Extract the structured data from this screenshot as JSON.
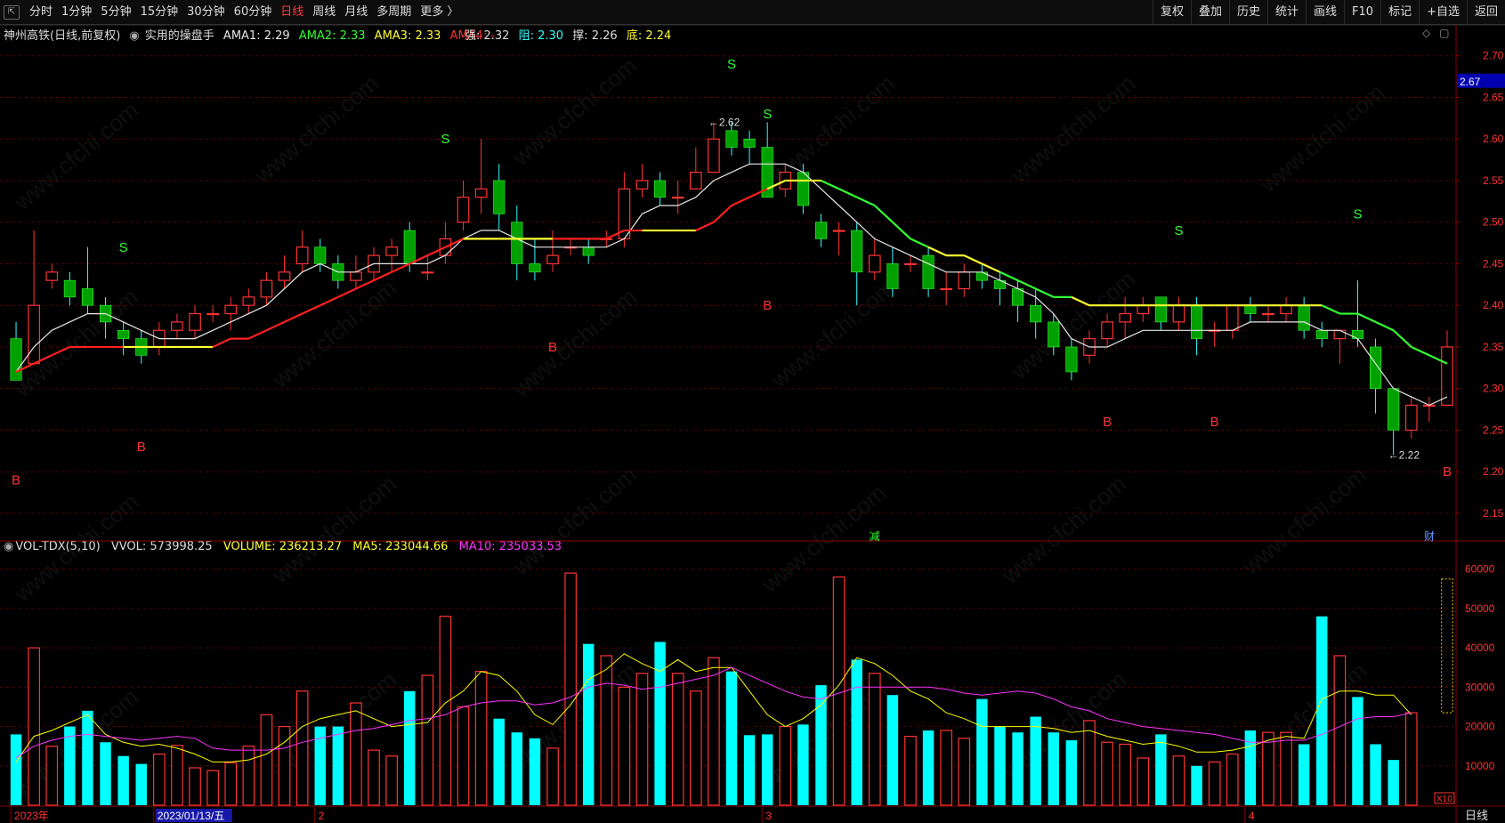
{
  "toolbar": {
    "periods": [
      "分时",
      "1分钟",
      "5分钟",
      "15分钟",
      "30分钟",
      "60分钟",
      "日线",
      "周线",
      "月线",
      "多周期",
      "更多 〉"
    ],
    "active_period": "日线",
    "right_buttons": [
      "复权",
      "叠加",
      "历史",
      "统计",
      "画线",
      "F10",
      "标记",
      "+自选",
      "返回"
    ]
  },
  "header": {
    "stock_name": "神州高铁(日线,前复权)",
    "indicator_name": "实用的操盘手",
    "ama1": "AMA1: 2.29",
    "ama2": "AMA2: 2.33",
    "ama3": "AMA3: 2.33",
    "ama4": "AMA4: -",
    "strong": "强: 2.32",
    "resist": "阻: 2.30",
    "support": "撑: 2.26",
    "bottom": "底: 2.24"
  },
  "volume_header": {
    "name": "VOL-TDX(5,10)",
    "vvol": "VVOL: 573998.25",
    "volume": "VOLUME: 236213.27",
    "ma5": "MA5: 233044.66",
    "ma10": "MA10: 235033.53"
  },
  "colors": {
    "up": "#ff3333",
    "down": "#00a000",
    "vol_down": "#00ffff",
    "ama_white": "#e8e8e8",
    "ama_red": "#ff2020",
    "ama_yellow": "#ffff33",
    "ama_green": "#33ff33",
    "ma5": "#ffff00",
    "ma10": "#ff33ff",
    "grid": "#5a0000"
  },
  "corner_icons": [
    "diamond-icon",
    "panel-icon"
  ],
  "current_price_tag": "2.67",
  "event_marks": [
    "减",
    "财"
  ],
  "volume_unit_tag": "X10",
  "period_tag": "日线",
  "chart_data": [
    {
      "type": "candlestick",
      "ylim": [
        2.12,
        2.72
      ],
      "yticks": [
        "2.70",
        "2.65",
        "2.60",
        "2.55",
        "2.50",
        "2.45",
        "2.40",
        "2.35",
        "2.30",
        "2.25",
        "2.20",
        "2.15"
      ],
      "candles": [
        [
          2.36,
          2.31,
          2.38,
          2.31
        ],
        [
          2.33,
          2.4,
          2.49,
          2.33
        ],
        [
          2.43,
          2.44,
          2.45,
          2.42
        ],
        [
          2.43,
          2.41,
          2.44,
          2.4
        ],
        [
          2.42,
          2.4,
          2.47,
          2.39
        ],
        [
          2.4,
          2.38,
          2.41,
          2.36
        ],
        [
          2.37,
          2.36,
          2.38,
          2.34
        ],
        [
          2.36,
          2.34,
          2.37,
          2.33
        ],
        [
          2.35,
          2.37,
          2.38,
          2.34
        ],
        [
          2.37,
          2.38,
          2.39,
          2.36
        ],
        [
          2.37,
          2.39,
          2.4,
          2.36
        ],
        [
          2.39,
          2.39,
          2.4,
          2.38
        ],
        [
          2.39,
          2.4,
          2.41,
          2.37
        ],
        [
          2.4,
          2.41,
          2.42,
          2.39
        ],
        [
          2.41,
          2.43,
          2.44,
          2.4
        ],
        [
          2.43,
          2.44,
          2.46,
          2.42
        ],
        [
          2.45,
          2.47,
          2.49,
          2.44
        ],
        [
          2.47,
          2.45,
          2.48,
          2.44
        ],
        [
          2.45,
          2.43,
          2.46,
          2.42
        ],
        [
          2.43,
          2.44,
          2.46,
          2.42
        ],
        [
          2.44,
          2.46,
          2.47,
          2.43
        ],
        [
          2.46,
          2.47,
          2.48,
          2.44
        ],
        [
          2.49,
          2.45,
          2.5,
          2.44
        ],
        [
          2.44,
          2.44,
          2.46,
          2.43
        ],
        [
          2.46,
          2.48,
          2.5,
          2.45
        ],
        [
          2.5,
          2.53,
          2.55,
          2.49
        ],
        [
          2.53,
          2.54,
          2.6,
          2.51
        ],
        [
          2.55,
          2.51,
          2.57,
          2.49
        ],
        [
          2.5,
          2.45,
          2.52,
          2.43
        ],
        [
          2.45,
          2.44,
          2.48,
          2.43
        ],
        [
          2.45,
          2.46,
          2.49,
          2.44
        ],
        [
          2.47,
          2.47,
          2.48,
          2.46
        ],
        [
          2.47,
          2.46,
          2.48,
          2.45
        ],
        [
          2.48,
          2.48,
          2.49,
          2.47
        ],
        [
          2.48,
          2.54,
          2.56,
          2.47
        ],
        [
          2.54,
          2.55,
          2.57,
          2.53
        ],
        [
          2.55,
          2.53,
          2.56,
          2.52
        ],
        [
          2.53,
          2.53,
          2.55,
          2.51
        ],
        [
          2.54,
          2.56,
          2.59,
          2.54
        ],
        [
          2.56,
          2.6,
          2.62,
          2.56
        ],
        [
          2.61,
          2.59,
          2.62,
          2.58
        ],
        [
          2.6,
          2.59,
          2.61,
          2.57
        ],
        [
          2.59,
          2.53,
          2.62,
          2.53
        ],
        [
          2.54,
          2.56,
          2.57,
          2.53
        ],
        [
          2.56,
          2.52,
          2.57,
          2.51
        ],
        [
          2.5,
          2.48,
          2.51,
          2.47
        ],
        [
          2.49,
          2.49,
          2.5,
          2.46
        ],
        [
          2.49,
          2.44,
          2.5,
          2.4
        ],
        [
          2.44,
          2.46,
          2.48,
          2.43
        ],
        [
          2.45,
          2.42,
          2.47,
          2.41
        ],
        [
          2.45,
          2.45,
          2.46,
          2.44
        ],
        [
          2.46,
          2.42,
          2.47,
          2.41
        ],
        [
          2.42,
          2.42,
          2.44,
          2.4
        ],
        [
          2.42,
          2.44,
          2.45,
          2.41
        ],
        [
          2.44,
          2.43,
          2.45,
          2.42
        ],
        [
          2.43,
          2.42,
          2.44,
          2.4
        ],
        [
          2.42,
          2.4,
          2.43,
          2.38
        ],
        [
          2.4,
          2.38,
          2.42,
          2.36
        ],
        [
          2.38,
          2.35,
          2.39,
          2.34
        ],
        [
          2.35,
          2.32,
          2.36,
          2.31
        ],
        [
          2.34,
          2.36,
          2.37,
          2.33
        ],
        [
          2.36,
          2.38,
          2.39,
          2.35
        ],
        [
          2.38,
          2.39,
          2.41,
          2.36
        ],
        [
          2.39,
          2.4,
          2.41,
          2.38
        ],
        [
          2.41,
          2.38,
          2.41,
          2.37
        ],
        [
          2.38,
          2.4,
          2.41,
          2.37
        ],
        [
          2.4,
          2.36,
          2.41,
          2.34
        ],
        [
          2.37,
          2.37,
          2.38,
          2.35
        ],
        [
          2.37,
          2.4,
          2.4,
          2.36
        ],
        [
          2.4,
          2.39,
          2.41,
          2.38
        ],
        [
          2.39,
          2.39,
          2.4,
          2.38
        ],
        [
          2.39,
          2.4,
          2.41,
          2.38
        ],
        [
          2.4,
          2.37,
          2.41,
          2.36
        ],
        [
          2.37,
          2.36,
          2.38,
          2.35
        ],
        [
          2.36,
          2.37,
          2.37,
          2.33
        ],
        [
          2.37,
          2.36,
          2.43,
          2.35
        ],
        [
          2.35,
          2.3,
          2.36,
          2.27
        ],
        [
          2.3,
          2.25,
          2.3,
          2.22
        ],
        [
          2.25,
          2.28,
          2.29,
          2.24
        ],
        [
          2.28,
          2.28,
          2.29,
          2.26
        ],
        [
          2.28,
          2.35,
          2.37,
          2.28
        ]
      ],
      "ama_fast": [
        2.32,
        2.35,
        2.37,
        2.38,
        2.39,
        2.39,
        2.38,
        2.37,
        2.36,
        2.36,
        2.36,
        2.37,
        2.38,
        2.39,
        2.4,
        2.42,
        2.44,
        2.45,
        2.44,
        2.44,
        2.45,
        2.45,
        2.45,
        2.45,
        2.46,
        2.48,
        2.49,
        2.49,
        2.48,
        2.47,
        2.47,
        2.47,
        2.47,
        2.47,
        2.48,
        2.51,
        2.52,
        2.52,
        2.53,
        2.55,
        2.56,
        2.57,
        2.57,
        2.57,
        2.56,
        2.54,
        2.52,
        2.5,
        2.48,
        2.47,
        2.46,
        2.45,
        2.44,
        2.44,
        2.44,
        2.43,
        2.42,
        2.41,
        2.39,
        2.36,
        2.35,
        2.35,
        2.36,
        2.37,
        2.37,
        2.37,
        2.37,
        2.37,
        2.37,
        2.38,
        2.38,
        2.38,
        2.38,
        2.37,
        2.37,
        2.36,
        2.33,
        2.3,
        2.29,
        2.28,
        2.29
      ],
      "ama_slow_seg1": [
        2.32,
        2.33,
        2.34,
        2.35,
        2.35,
        2.35,
        2.35,
        2.35,
        2.35,
        2.35,
        2.35,
        2.35,
        2.36,
        2.36,
        2.37,
        2.38,
        2.39,
        2.4,
        2.41,
        2.42,
        2.43,
        2.44,
        2.45,
        2.46,
        2.47,
        2.48,
        2.48,
        2.48,
        2.48,
        2.48,
        2.48,
        2.48,
        2.48,
        2.48,
        2.49,
        2.49,
        2.49,
        2.49,
        2.49,
        2.5,
        2.52,
        2.53,
        2.54,
        2.55,
        2.55,
        2.55,
        2.54,
        2.53,
        2.52,
        2.5,
        2.48,
        2.47,
        2.46,
        2.46,
        2.45,
        2.44,
        2.43,
        2.42,
        2.41,
        2.41,
        2.4,
        2.4,
        2.4,
        2.4,
        2.4,
        2.4,
        2.4,
        2.4,
        2.4,
        2.4,
        2.4,
        2.4,
        2.4,
        2.4,
        2.39,
        2.39,
        2.38,
        2.37,
        2.35,
        2.34,
        2.33
      ],
      "ama_slow_colors": [
        "red",
        "red",
        "red",
        "red",
        "red",
        "red",
        "red",
        "yellow",
        "yellow",
        "yellow",
        "yellow",
        "yellow",
        "red",
        "red",
        "red",
        "red",
        "red",
        "red",
        "red",
        "red",
        "red",
        "red",
        "red",
        "red",
        "red",
        "red",
        "yellow",
        "yellow",
        "yellow",
        "yellow",
        "yellow",
        "red",
        "red",
        "red",
        "red",
        "red",
        "yellow",
        "yellow",
        "yellow",
        "red",
        "red",
        "red",
        "red",
        "yellow",
        "yellow",
        "yellow",
        "green",
        "green",
        "green",
        "green",
        "green",
        "green",
        "yellow",
        "yellow",
        "yellow",
        "yellow",
        "green",
        "green",
        "green",
        "green",
        "yellow",
        "yellow",
        "yellow",
        "yellow",
        "yellow",
        "yellow",
        "yellow",
        "yellow",
        "yellow",
        "yellow",
        "yellow",
        "yellow",
        "yellow",
        "yellow",
        "green",
        "green",
        "green",
        "green",
        "green",
        "green",
        "green"
      ],
      "signals": [
        {
          "label": "S",
          "i": 6,
          "price": 2.47
        },
        {
          "label": "S",
          "i": 24,
          "price": 2.6
        },
        {
          "label": "S",
          "i": 40,
          "price": 2.69
        },
        {
          "label": "S",
          "i": 42,
          "price": 2.63
        },
        {
          "label": "S",
          "i": 65,
          "price": 2.49
        },
        {
          "label": "S",
          "i": 75,
          "price": 2.51
        },
        {
          "label": "B",
          "i": 0,
          "price": 2.19
        },
        {
          "label": "B",
          "i": 7,
          "price": 2.23
        },
        {
          "label": "B",
          "i": 30,
          "price": 2.35
        },
        {
          "label": "B",
          "i": 42,
          "price": 2.4
        },
        {
          "label": "B",
          "i": 61,
          "price": 2.26
        },
        {
          "label": "B",
          "i": 67,
          "price": 2.26
        },
        {
          "label": "B",
          "i": 80,
          "price": 2.2
        }
      ],
      "annotations": [
        {
          "text": "2.62",
          "i": 39,
          "price": 2.62
        },
        {
          "text": "2.22",
          "i": 77,
          "price": 2.22
        }
      ]
    },
    {
      "type": "bar",
      "ylim": [
        0,
        64000
      ],
      "yticks": [
        "60000",
        "50000",
        "40000",
        "30000",
        "20000",
        "10000"
      ],
      "volumes": [
        18000,
        40000,
        15000,
        20000,
        24000,
        16000,
        12500,
        10500,
        13000,
        15200,
        9500,
        8800,
        10800,
        15000,
        23000,
        20000,
        29000,
        20000,
        20000,
        26000,
        14000,
        12500,
        29000,
        33000,
        48000,
        25000,
        34000,
        22000,
        18500,
        17000,
        14500,
        59000,
        41000,
        38000,
        30000,
        33500,
        41500,
        33500,
        29000,
        37500,
        34000,
        17800,
        18000,
        20000,
        20500,
        30500,
        58000,
        37000,
        33500,
        28000,
        17500,
        19000,
        19000,
        17000,
        27000,
        20000,
        18500,
        22500,
        18500,
        16500,
        21500,
        16000,
        15500,
        12000,
        18000,
        12500,
        10000,
        11000,
        13000,
        19000,
        18500,
        18500,
        15500,
        48000,
        38000,
        27500,
        15500,
        11500,
        23500
      ],
      "ma5": [
        11000,
        17500,
        19000,
        21000,
        23000,
        18000,
        16000,
        15000,
        15500,
        14500,
        13000,
        11000,
        11000,
        11500,
        13000,
        16000,
        20000,
        22000,
        23000,
        24000,
        22000,
        20000,
        20500,
        21000,
        26000,
        29000,
        34000,
        33000,
        29000,
        23000,
        20500,
        25500,
        32000,
        34500,
        38500,
        36000,
        34000,
        37000,
        34000,
        35000,
        35000,
        29000,
        23000,
        20000,
        22000,
        25500,
        30500,
        37500,
        36000,
        33000,
        29000,
        27000,
        23500,
        22000,
        20000,
        20000,
        20000,
        20000,
        19500,
        18500,
        19000,
        17500,
        16500,
        15500,
        16000,
        15000,
        13500,
        13500,
        14000,
        15000,
        16500,
        17500,
        17000,
        27000,
        29000,
        29000,
        28000,
        28000,
        23000
      ],
      "ma10": [
        12000,
        15000,
        16500,
        17500,
        18000,
        17500,
        17000,
        16500,
        17000,
        17500,
        17000,
        14500,
        14000,
        14000,
        14000,
        14500,
        16000,
        17000,
        18000,
        19000,
        19500,
        20500,
        21500,
        22000,
        23000,
        25000,
        26000,
        26500,
        26500,
        25500,
        26000,
        27500,
        30000,
        31000,
        30500,
        29500,
        30000,
        31000,
        32000,
        33000,
        35000,
        33000,
        31000,
        29000,
        27500,
        27000,
        28500,
        30000,
        30000,
        30000,
        30000,
        30000,
        29500,
        28500,
        28000,
        28500,
        29000,
        28500,
        27000,
        25000,
        24000,
        22000,
        21000,
        20000,
        19500,
        19000,
        18500,
        18000,
        17000,
        16000,
        16000,
        16500,
        16500,
        18000,
        20000,
        22000,
        22500,
        22500,
        23500
      ]
    }
  ],
  "x_axis": {
    "labels": [
      "2023年",
      "2023/01/13/五",
      "2",
      "3",
      "4"
    ],
    "positions_index": [
      0,
      8,
      17,
      42,
      69
    ]
  }
}
